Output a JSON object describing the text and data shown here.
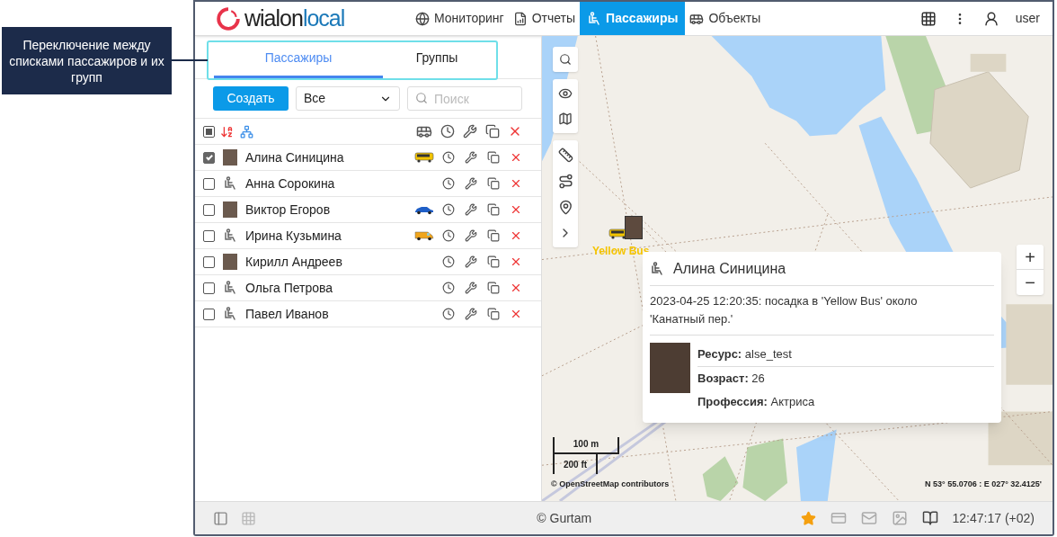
{
  "annotation": {
    "text": "Переключение между списками пассажиров и их групп"
  },
  "header": {
    "logo": {
      "part_1": "wialon",
      "part_2": "local"
    },
    "nav": [
      {
        "label": "Мониторинг",
        "kind": "globe",
        "selected": false
      },
      {
        "label": "Отчеты",
        "kind": "report",
        "selected": false
      },
      {
        "label": "Пассажиры",
        "kind": "passenger",
        "selected": true
      },
      {
        "label": "Объекты",
        "kind": "bus",
        "selected": false
      }
    ],
    "user": "user"
  },
  "panel": {
    "tabs": [
      {
        "label": "Пассажиры",
        "selected": true
      },
      {
        "label": "Группы",
        "selected": false
      }
    ],
    "create_button": "Создать",
    "filter": {
      "value": "Все"
    },
    "search": {
      "placeholder": "Поиск"
    },
    "select_all": {
      "indeterminate": true
    },
    "rows": [
      {
        "name": "Алина Синицина",
        "checked": true,
        "avatar": {
          "kind": "photo"
        },
        "vehicle": {
          "kind": "bus"
        }
      },
      {
        "name": "Анна Сорокина",
        "checked": false,
        "avatar": {
          "kind": "seat"
        }
      },
      {
        "name": "Виктор Егоров",
        "checked": false,
        "avatar": {
          "kind": "photo"
        },
        "vehicle": {
          "kind": "car"
        }
      },
      {
        "name": "Ирина Кузьмина",
        "checked": false,
        "avatar": {
          "kind": "seat"
        },
        "vehicle": {
          "kind": "van"
        }
      },
      {
        "name": "Кирилл Андреев",
        "checked": false,
        "avatar": {
          "kind": "photo"
        }
      },
      {
        "name": "Ольга Петрова",
        "checked": false,
        "avatar": {
          "kind": "seat"
        }
      },
      {
        "name": "Павел Иванов",
        "checked": false,
        "avatar": {
          "kind": "seat"
        }
      }
    ]
  },
  "map": {
    "marker_label": "Yellow Bus",
    "scale": [
      "100 m",
      "200 ft"
    ],
    "attribution": "© OpenStreetMap contributors",
    "coordinates": "N 53° 55.0706 : E 027° 32.4125'",
    "zoom": [
      "+",
      "−"
    ],
    "popup": {
      "title": "Алина Синицина",
      "event": "2023-04-25 12:20:35: посадка в 'Yellow Bus' около 'Канатный пер.'",
      "fields": [
        "**Ресурс:** alse_test",
        "**Возраст:** 26",
        "**Профессия:** Актриса"
      ]
    }
  },
  "footer": {
    "copyright": "© Gurtam",
    "time": "12:47:17 (+02)"
  }
}
